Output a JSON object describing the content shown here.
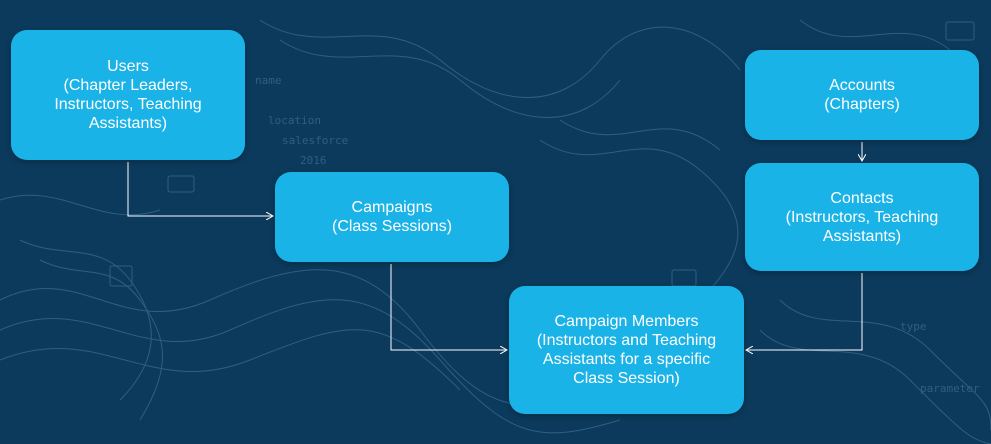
{
  "colors": {
    "background": "#0b3a5c",
    "box_fill": "#1ab3e7",
    "box_text": "#ffffff",
    "connector": "#ffffff"
  },
  "nodes": {
    "users": {
      "lines": [
        "Users",
        "(Chapter Leaders,",
        "Instructors, Teaching",
        "Assistants)"
      ]
    },
    "campaigns": {
      "lines": [
        "Campaigns",
        "(Class Sessions)"
      ]
    },
    "campaign_members": {
      "lines": [
        "Campaign Members",
        "(Instructors and Teaching",
        "Assistants for a specific",
        "Class Session)"
      ]
    },
    "accounts": {
      "lines": [
        "Accounts",
        "(Chapters)"
      ]
    },
    "contacts": {
      "lines": [
        "Contacts",
        "(Instructors, Teaching",
        "Assistants)"
      ]
    }
  },
  "edges": [
    {
      "from": "users",
      "to": "campaigns"
    },
    {
      "from": "campaigns",
      "to": "campaign_members"
    },
    {
      "from": "accounts",
      "to": "contacts"
    },
    {
      "from": "contacts",
      "to": "campaign_members"
    }
  ]
}
